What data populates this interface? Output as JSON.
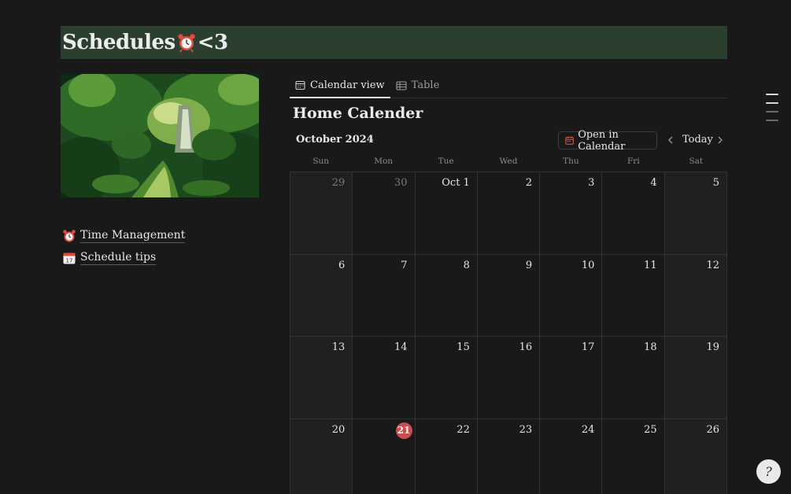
{
  "page": {
    "title_prefix": "Schedules",
    "title_suffix": "<3"
  },
  "links": [
    {
      "label": "Time Management",
      "icon": "alarm-clock-icon"
    },
    {
      "label": "Schedule tips",
      "icon": "calendar-icon"
    }
  ],
  "tabs": [
    {
      "label": "Calendar view",
      "active": true
    },
    {
      "label": "Table",
      "active": false
    }
  ],
  "calendar": {
    "title": "Home Calender",
    "month": "October 2024",
    "open_button": "Open in Calendar",
    "today_button": "Today",
    "weekdays": [
      "Sun",
      "Mon",
      "Tue",
      "Wed",
      "Thu",
      "Fri",
      "Sat"
    ],
    "today": "21",
    "today_color": "#cf4b4b",
    "weeks": [
      [
        {
          "n": "29",
          "m": true
        },
        {
          "n": "30",
          "m": true
        },
        {
          "n": "Oct 1"
        },
        {
          "n": "2"
        },
        {
          "n": "3"
        },
        {
          "n": "4"
        },
        {
          "n": "5"
        }
      ],
      [
        {
          "n": "6"
        },
        {
          "n": "7"
        },
        {
          "n": "8"
        },
        {
          "n": "9"
        },
        {
          "n": "10"
        },
        {
          "n": "11"
        },
        {
          "n": "12"
        }
      ],
      [
        {
          "n": "13"
        },
        {
          "n": "14"
        },
        {
          "n": "15"
        },
        {
          "n": "16"
        },
        {
          "n": "17"
        },
        {
          "n": "18"
        },
        {
          "n": "19"
        }
      ],
      [
        {
          "n": "20"
        },
        {
          "n": "21"
        },
        {
          "n": "22"
        },
        {
          "n": "23"
        },
        {
          "n": "24"
        },
        {
          "n": "25"
        },
        {
          "n": "26"
        }
      ]
    ]
  },
  "help": {
    "label": "?"
  },
  "colors": {
    "title_bar": "#2b3f2f",
    "background": "#191919"
  }
}
